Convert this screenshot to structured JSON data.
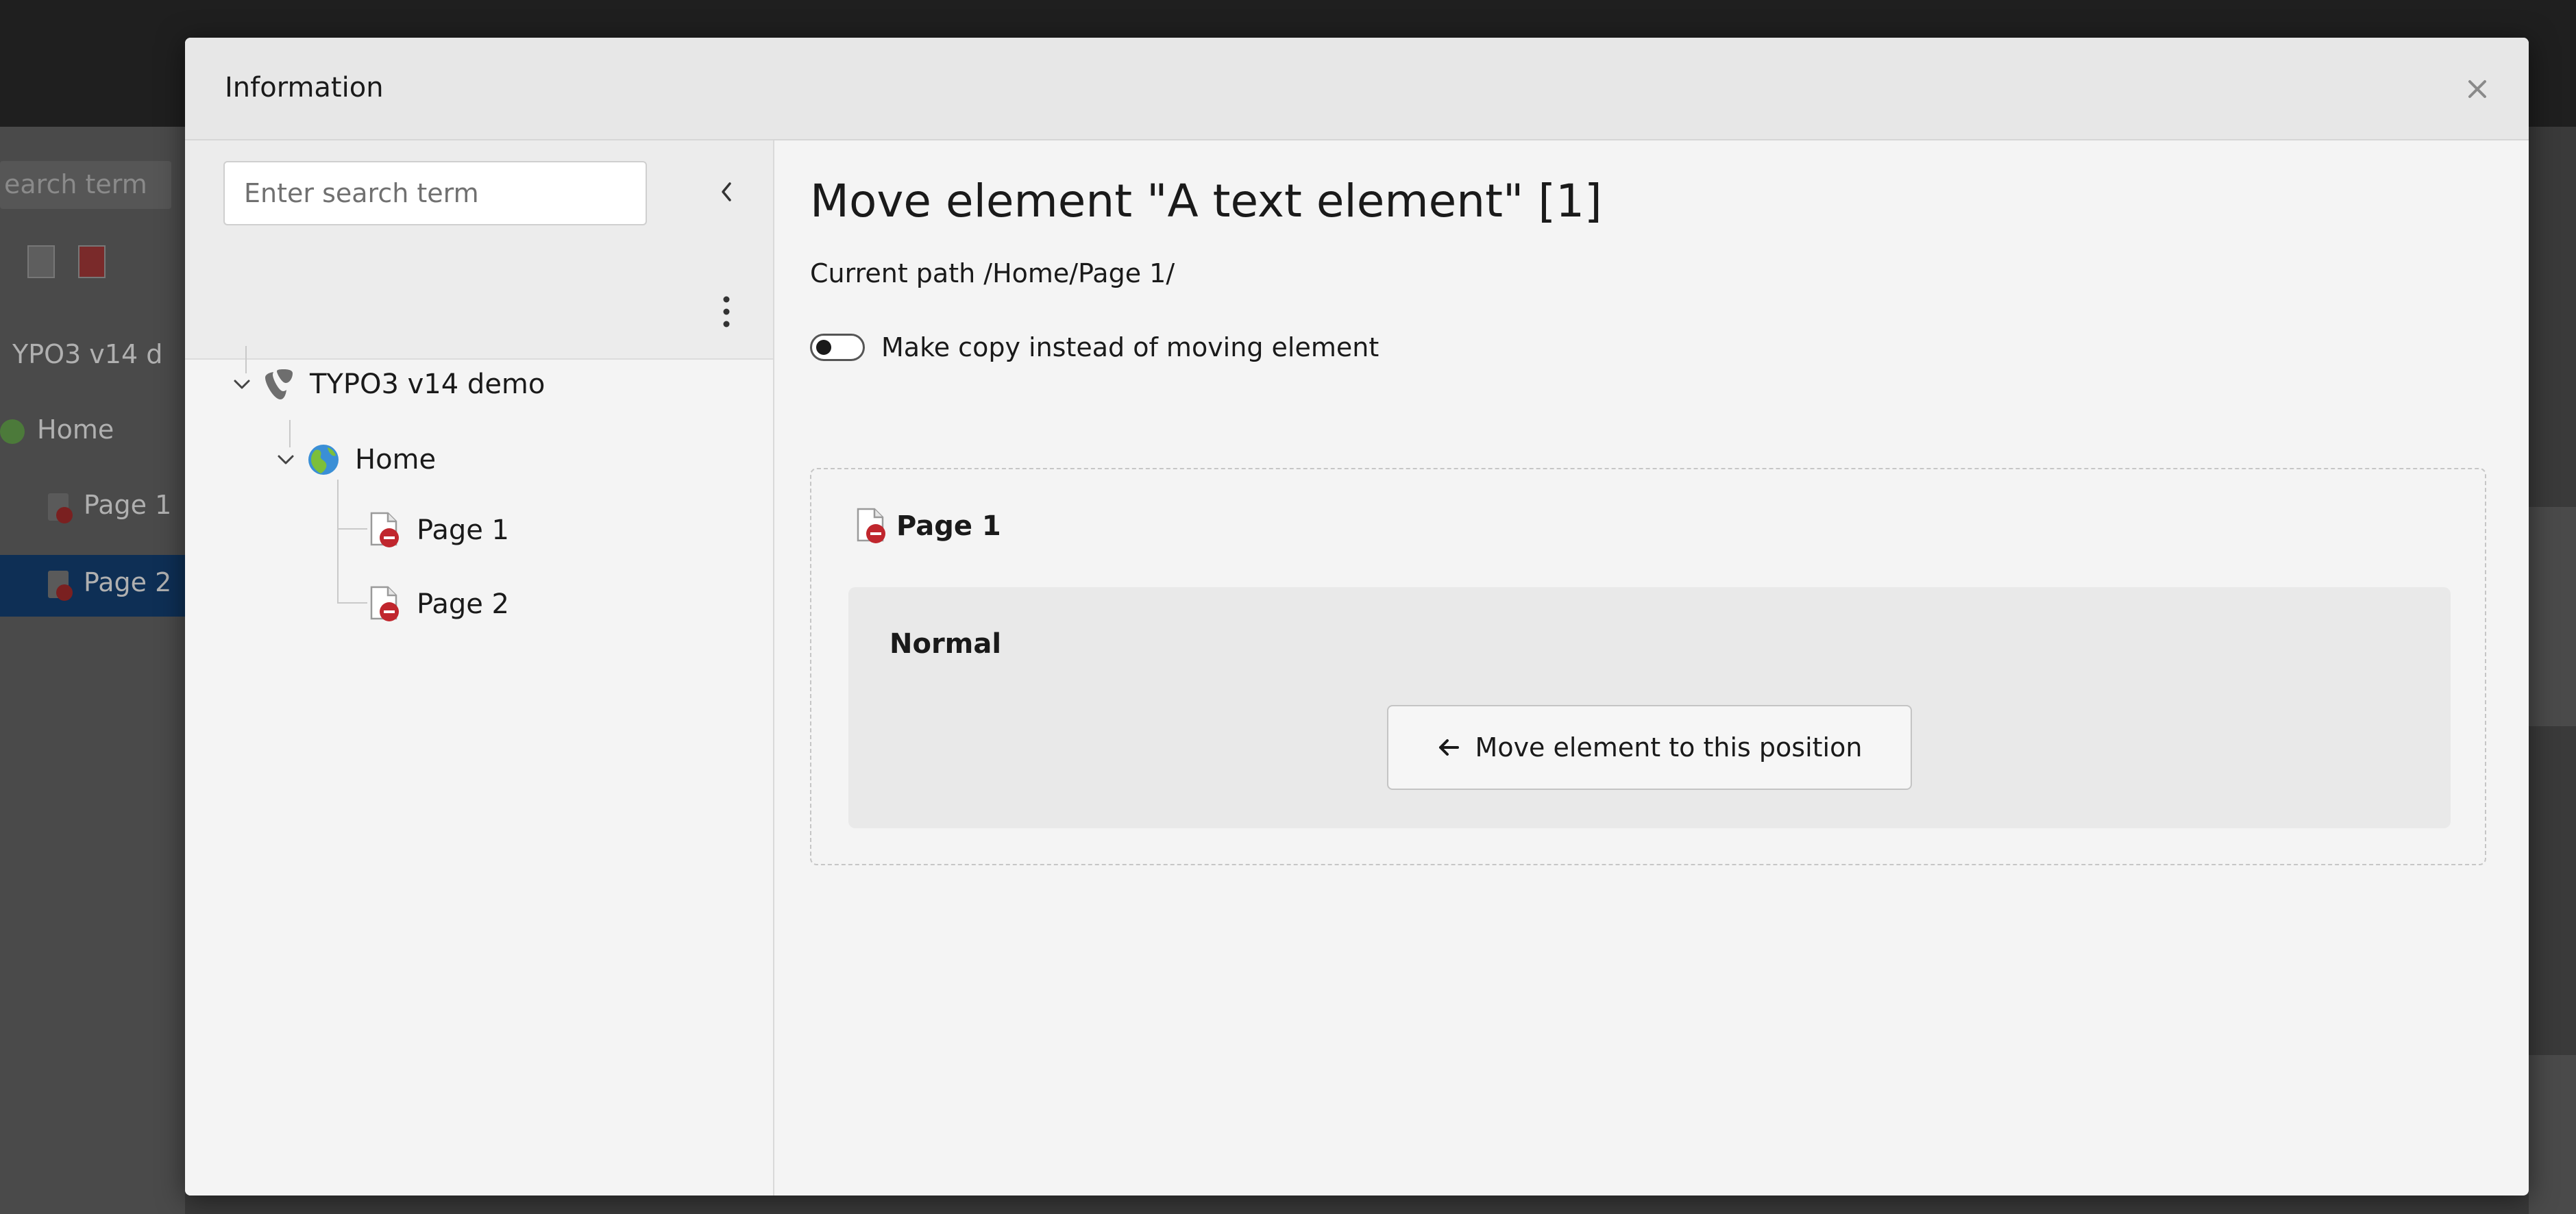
{
  "background": {
    "search_text": "earch term",
    "tree_rows": [
      "YPO3 v14 d",
      "Home",
      "Page 1",
      "Page 2"
    ]
  },
  "modal": {
    "title": "Information",
    "close_icon": "close-icon"
  },
  "tree_panel": {
    "search_placeholder": "Enter search term",
    "collapse_icon": "chevron-left-icon",
    "menu_icon": "kebab-menu-icon",
    "nodes": [
      {
        "label": "TYPO3 v14 demo",
        "icon": "typo3-logo-icon",
        "expanded": true
      },
      {
        "label": "Home",
        "icon": "globe-icon",
        "expanded": true
      },
      {
        "label": "Page 1",
        "icon": "page-hidden-icon"
      },
      {
        "label": "Page 2",
        "icon": "page-hidden-icon"
      }
    ]
  },
  "content": {
    "title": "Move element \"A text element\" [1]",
    "current_path": "Current path /Home/Page 1/",
    "toggle_label": "Make copy instead of moving element",
    "toggle_on": false,
    "page": {
      "title": "Page 1",
      "column": {
        "title": "Normal",
        "move_button_label": "Move element to this position"
      }
    }
  },
  "colors": {
    "modal_bg": "#f4f4f4",
    "header_bg": "#e7e7e7",
    "page_badge_red": "#c0262d",
    "globe_blue": "#3a8fd6",
    "globe_green": "#7cbf3a",
    "selected_bg": "#0e2f55"
  }
}
